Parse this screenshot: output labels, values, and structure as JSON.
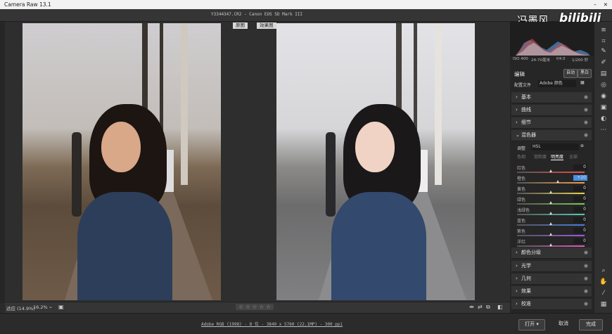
{
  "window": {
    "title": "Camera Raw 13.1"
  },
  "file_info": "Y3344347.CR2  -  Canon EOS 5D Mark III",
  "watermark": {
    "text": "冯墨风",
    "logo": "bilibili"
  },
  "view_labels": {
    "before": "原图",
    "after": "效果图"
  },
  "camera_info": {
    "iso": "ISO 400",
    "lens": "24-70毫米",
    "aperture": "f/4.0",
    "shutter": "1/200 秒"
  },
  "edit": {
    "label": "编辑",
    "auto": "自动",
    "bw": "黑白",
    "profile_label": "配置文件",
    "profile_value": "Adobe 颜色"
  },
  "sections_top": [
    {
      "label": "基本"
    },
    {
      "label": "曲线"
    },
    {
      "label": "细节"
    }
  ],
  "color_mixer": {
    "label": "混色器",
    "adjust_label": "调整",
    "adjust_value": "HSL",
    "tabs": [
      "色相",
      "饱和度",
      "明亮度",
      "全部"
    ],
    "active_tab": 2,
    "sliders": [
      {
        "name": "红色",
        "value": "0",
        "pos": 0.5,
        "color_start": "#e84b4b",
        "color_end": "#e84b4b"
      },
      {
        "name": "橙色",
        "value": "+20",
        "pos": 0.6,
        "color_start": "#f0a050",
        "color_end": "#f0a050"
      },
      {
        "name": "黄色",
        "value": "0",
        "pos": 0.5,
        "color_start": "#e8d34b",
        "color_end": "#e8d34b"
      },
      {
        "name": "绿色",
        "value": "0",
        "pos": 0.5,
        "color_start": "#7ac95a",
        "color_end": "#7ac95a"
      },
      {
        "name": "浅绿色",
        "value": "0",
        "pos": 0.5,
        "color_start": "#5ac9b4",
        "color_end": "#5ac9b4"
      },
      {
        "name": "蓝色",
        "value": "0",
        "pos": 0.5,
        "color_start": "#4a7be8",
        "color_end": "#4a7be8"
      },
      {
        "name": "紫色",
        "value": "0",
        "pos": 0.5,
        "color_start": "#9a5ae8",
        "color_end": "#9a5ae8"
      },
      {
        "name": "洋红",
        "value": "0",
        "pos": 0.5,
        "color_start": "#e05ac0",
        "color_end": "#e05ac0"
      }
    ]
  },
  "sections_bottom": [
    {
      "label": "颜色分级"
    },
    {
      "label": "光学"
    },
    {
      "label": "几何"
    },
    {
      "label": "效果"
    },
    {
      "label": "校准"
    }
  ],
  "zoom": {
    "fit": "适应 (14.9%)",
    "value": "16.2%"
  },
  "rating": "☆ ☆ ☆ ☆ ☆",
  "workflow": "Adobe RGB (1998) - 8 位 - 3840 x 5760 (22.1MP) - 300 ppi",
  "buttons": {
    "open": "打开",
    "cancel": "取消",
    "done": "完成"
  },
  "colors": {
    "accent": "#4a90e2",
    "panel": "#262626",
    "section": "#333333"
  }
}
